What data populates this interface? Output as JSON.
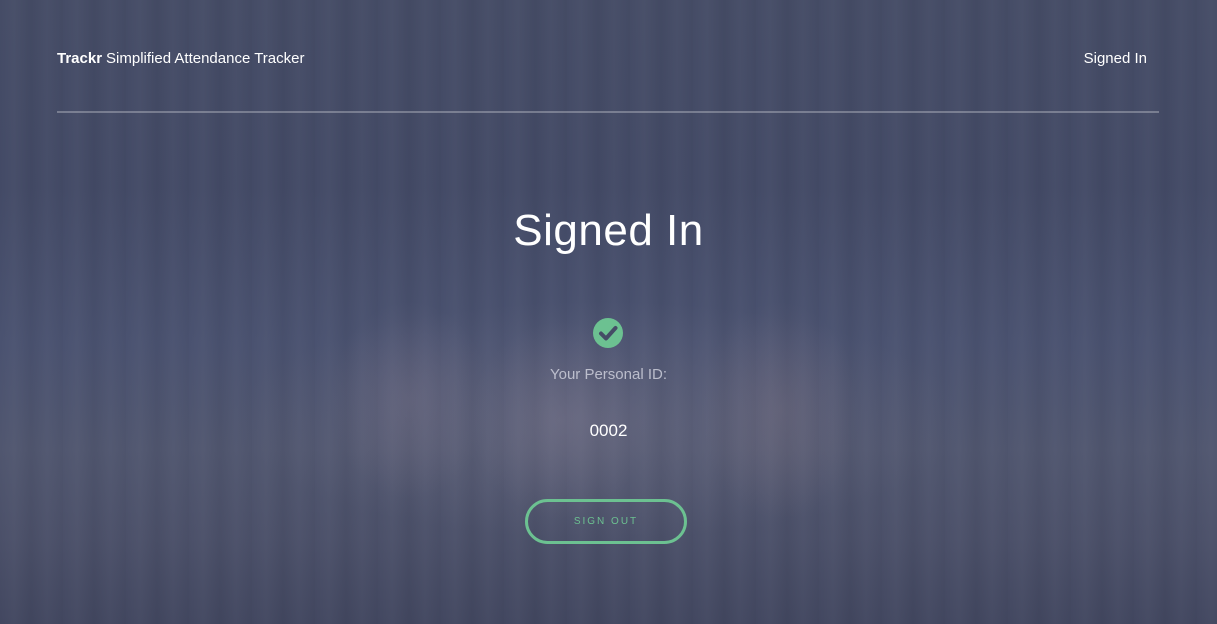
{
  "header": {
    "brand_name": "Trackr",
    "brand_tagline": "Simplified Attendance Tracker",
    "nav_link": "Signed In"
  },
  "main": {
    "title": "Signed In",
    "status_icon": "check-circle-icon",
    "id_label": "Your Personal ID:",
    "id_value": "0002",
    "sign_out_label": "SIGN OUT"
  },
  "colors": {
    "accent": "#6cc191",
    "background": "#464d68"
  }
}
